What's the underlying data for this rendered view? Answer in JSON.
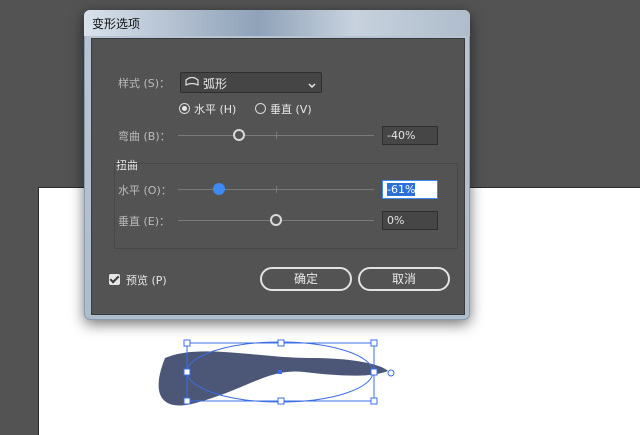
{
  "dialog": {
    "title": "变形选项",
    "style": {
      "label": "样式 (S)：",
      "value": "弧形",
      "icon": "arc-shape-icon"
    },
    "orientation": {
      "horizontal_label": "水平 (H)",
      "vertical_label": "垂直 (V)",
      "selected": "horizontal"
    },
    "bend": {
      "label": "弯曲 (B)：",
      "value": "-40%",
      "fraction": 0.3
    },
    "distortion": {
      "group_label": "扭曲",
      "horizontal": {
        "label": "水平 (O)：",
        "value": "-61%",
        "fraction": 0.195,
        "focused": true
      },
      "vertical": {
        "label": "垂直 (E)：",
        "value": "0%",
        "fraction": 0.5
      }
    },
    "preview": {
      "label": "预览 (P)",
      "checked": true
    },
    "ok_label": "确定",
    "cancel_label": "取消"
  },
  "colors": {
    "selection": "#3d6de4",
    "shape_fill": "#4c5677",
    "slider_active": "#3d8bf2"
  }
}
